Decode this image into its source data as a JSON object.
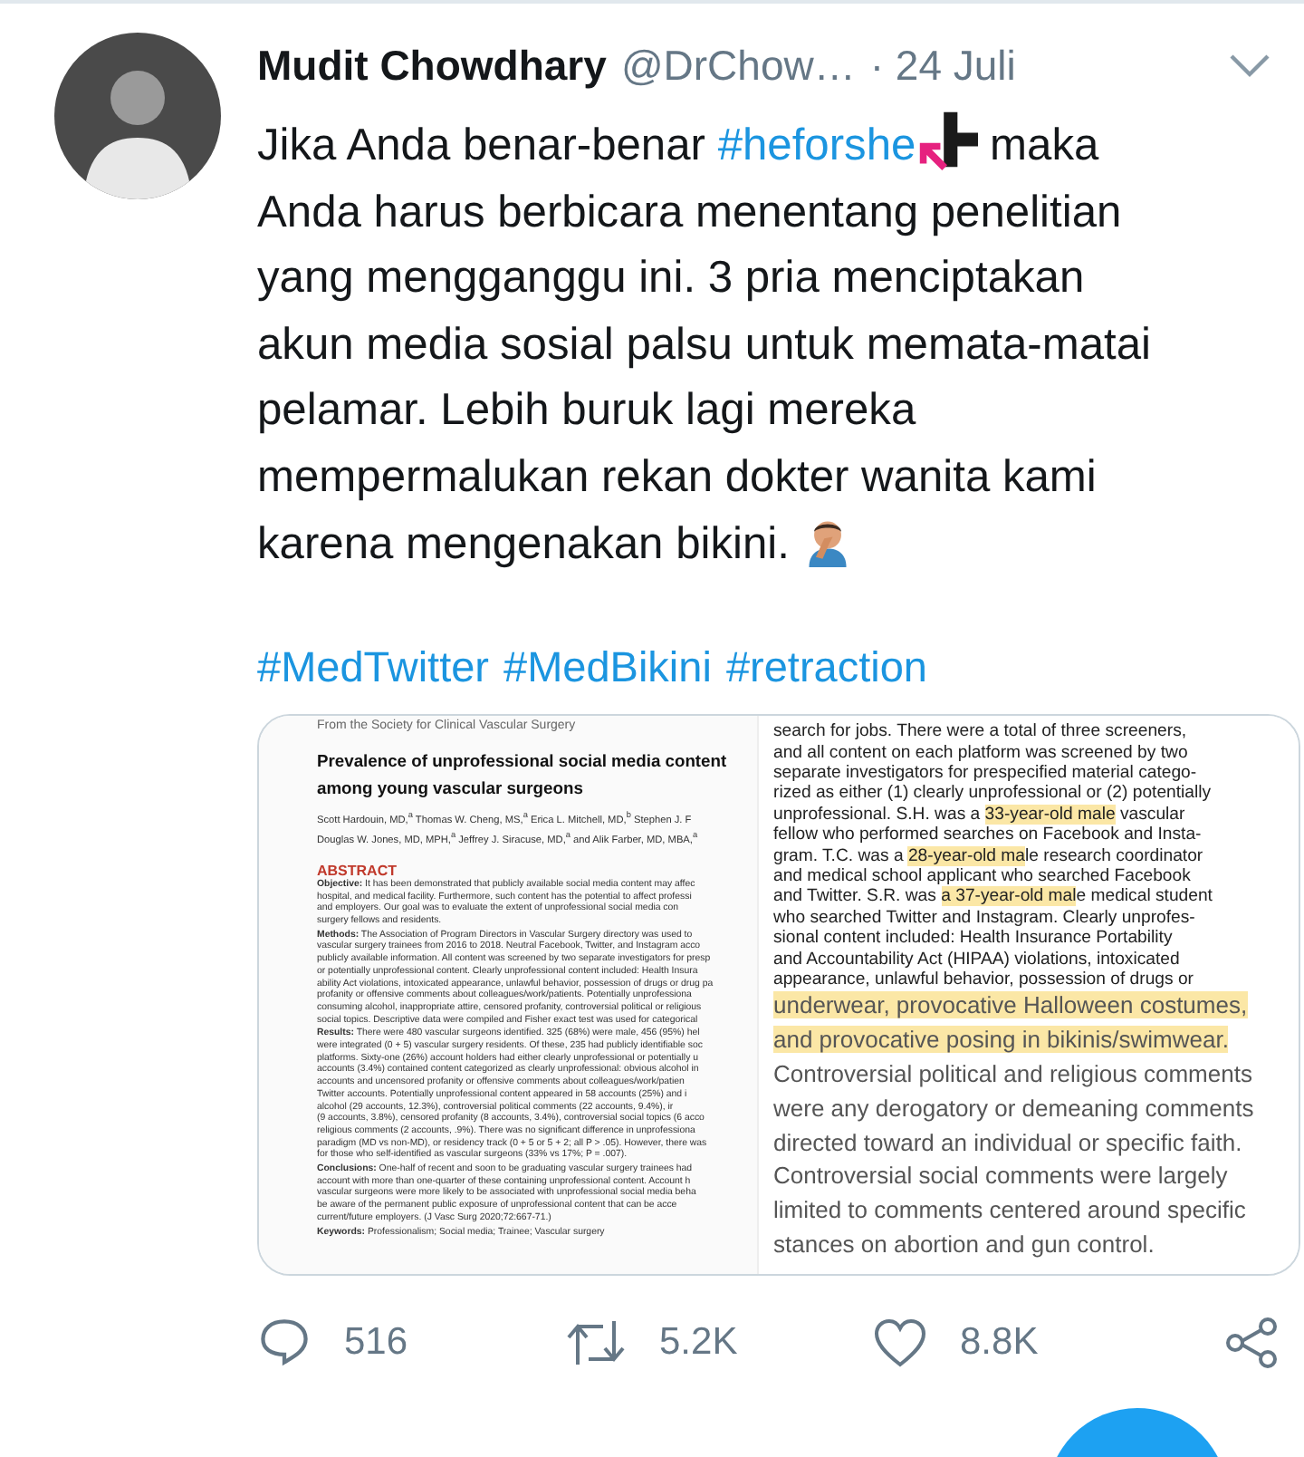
{
  "tweet": {
    "author": {
      "name": "Mudit Chowdhary",
      "handle": "@DrChow…",
      "date": "· 24 Juli"
    },
    "body": [
      {
        "kind": "text",
        "text": "Jika Anda benar-benar "
      },
      {
        "kind": "hashtag",
        "text": "#heforshe"
      },
      {
        "kind": "logo"
      },
      {
        "kind": "text",
        "text": " maka Anda harus berbicara menentang penelitian yang mengganggu ini. 3 pria menciptakan akun media sosial palsu untuk memata-matai pelamar. Lebih buruk lagi mereka mempermalukan rekan dokter wanita kami karena mengenakan bikini. "
      },
      {
        "kind": "emoji"
      }
    ],
    "hashtags": [
      "#MedTwitter",
      "#MedBikini",
      "#retraction"
    ],
    "media": {
      "left_page": {
        "source": "From the Society for Clinical Vascular Surgery",
        "title": [
          "Prevalence of unprofessional social media content",
          "among young vascular surgeons"
        ],
        "authors": [
          "Scott Hardouin, MD,$^{a}$ Thomas W. Cheng, MS,$^{a}$ Erica L. Mitchell, MD,$^{b}$ Stephen J. F",
          "Douglas W. Jones, MD, MPH,$^{a}$ Jeffrey J. Siracuse, MD,$^{a}$ and Alik Farber, MD, MBA,$^{a}$"
        ],
        "heading": "ABSTRACT",
        "paragraphs": [
          [
            "**Objective:** It has been demonstrated that publicly available social media content may affec",
            "hospital, and medical facility. Furthermore, such content has the potential to affect professi",
            "and employers. Our goal was to evaluate the extent of unprofessional social media con",
            "surgery fellows and residents."
          ],
          [
            "**Methods:** The Association of Program Directors in Vascular Surgery directory was used to",
            "vascular surgery trainees from 2016 to 2018. Neutral Facebook, Twitter, and Instagram acco",
            "publicly available information. All content was screened by two separate investigators for presp",
            "or potentially unprofessional content. Clearly unprofessional content included: Health Insura",
            "ability Act violations, intoxicated appearance, unlawful behavior, possession of drugs or drug pa",
            "profanity or offensive comments about colleagues/work/patients. Potentially unprofessiona",
            "consuming alcohol, inappropriate attire, censored profanity, controversial political or religious",
            "social topics. Descriptive data were compiled and Fisher exact test was used for categorical"
          ],
          [
            "**Results:** There were 480 vascular surgeons identified. 325 (68%) were male, 456 (95%) hel",
            "were integrated (0 + 5) vascular surgery residents. Of these, 235 had publicly identifiable soc",
            "platforms. Sixty-one (26%) account holders had either clearly unprofessional or potentially u",
            "accounts (3.4%) contained content categorized as clearly unprofessional: obvious alcohol in",
            "accounts and uncensored profanity or offensive comments about colleagues/work/patien",
            "Twitter accounts. Potentially unprofessional content appeared in 58 accounts (25%) and i",
            "alcohol (29 accounts, 12.3%), controversial political comments (22 accounts, 9.4%), ir",
            "(9 accounts, 3.8%), censored profanity (8 accounts, 3.4%), controversial social topics (6 acco",
            "religious comments (2 accounts, .9%). There was no significant difference in unprofessiona",
            "paradigm (MD vs non-MD), or residency track (0 + 5 or 5 + 2; all P > .05). However, there was",
            "for those who self-identified as vascular surgeons (33% vs 17%; P = .007)."
          ],
          [
            "**Conclusions:** One-half of recent and soon to be graduating vascular surgery trainees had",
            "account with more than one-quarter of these containing unprofessional content. Account h",
            "vascular surgeons were more likely to be associated with unprofessional social media beha",
            "be aware of the permanent public exposure of unprofessional content that can be acce",
            "current/future employers. (J Vasc Surg 2020;72:667-71.)"
          ],
          [
            "**Keywords:** Professionalism; Social media; Trainee; Vascular surgery"
          ]
        ]
      },
      "right_page": [
        {
          "kind": "small",
          "segments": [
            {
              "text": "search for jobs. There were a total of three screeners,",
              "highlight": false
            }
          ]
        },
        {
          "kind": "small",
          "segments": [
            {
              "text": "and all content on each platform was screened by two",
              "highlight": false
            }
          ]
        },
        {
          "kind": "small",
          "segments": [
            {
              "text": "separate investigators for prespecified material catego-",
              "highlight": false
            }
          ]
        },
        {
          "kind": "small",
          "segments": [
            {
              "text": "rized as either (1) clearly unprofessional or (2) potentially",
              "highlight": false
            }
          ]
        },
        {
          "kind": "small",
          "segments": [
            {
              "text": "unprofessional. S.H. was a ",
              "highlight": false
            },
            {
              "text": "33-year-old male",
              "highlight": true
            },
            {
              "text": " vascular",
              "highlight": false
            }
          ]
        },
        {
          "kind": "small",
          "segments": [
            {
              "text": "fellow who performed searches on Facebook and Insta-",
              "highlight": false
            }
          ]
        },
        {
          "kind": "small",
          "segments": [
            {
              "text": "gram. T.C. was a ",
              "highlight": false
            },
            {
              "text": "28-year-old ma",
              "highlight": true
            },
            {
              "text": "le research coordinator",
              "highlight": false
            }
          ]
        },
        {
          "kind": "small",
          "segments": [
            {
              "text": "and medical school applicant who searched Facebook",
              "highlight": false
            }
          ]
        },
        {
          "kind": "small",
          "segments": [
            {
              "text": "and Twitter. S.R. was ",
              "highlight": false
            },
            {
              "text": "a 37-year-old mal",
              "highlight": true
            },
            {
              "text": "e medical student",
              "highlight": false
            }
          ]
        },
        {
          "kind": "small",
          "segments": [
            {
              "text": "who searched Twitter and Instagram. Clearly unprofes-",
              "highlight": false
            }
          ]
        },
        {
          "kind": "small",
          "segments": [
            {
              "text": "sional content included: Health Insurance Portability",
              "highlight": false
            }
          ]
        },
        {
          "kind": "small",
          "segments": [
            {
              "text": "and Accountability Act (HIPAA) violations, intoxicated",
              "highlight": false
            }
          ]
        },
        {
          "kind": "small",
          "segments": [
            {
              "text": "appearance, unlawful behavior, possession of drugs or",
              "highlight": false
            }
          ]
        },
        {
          "kind": "large",
          "segments": [
            {
              "text": "underwear, provocative Halloween costumes,",
              "highlight": true
            }
          ]
        },
        {
          "kind": "large",
          "segments": [
            {
              "text": "and provocative posing in bikinis/swimwear.",
              "highlight": true
            }
          ]
        },
        {
          "kind": "large",
          "segments": [
            {
              "text": "Controversial political and religious comments",
              "highlight": false
            }
          ]
        },
        {
          "kind": "large",
          "segments": [
            {
              "text": "were any derogatory or demeaning comments",
              "highlight": false
            }
          ]
        },
        {
          "kind": "large",
          "segments": [
            {
              "text": "directed toward an individual or specific faith.",
              "highlight": false
            }
          ]
        },
        {
          "kind": "large",
          "segments": [
            {
              "text": "Controversial social comments were largely",
              "highlight": false
            }
          ]
        },
        {
          "kind": "large",
          "segments": [
            {
              "text": "limited to comments centered around specific",
              "highlight": false
            }
          ]
        },
        {
          "kind": "large",
          "segments": [
            {
              "text": "stances on abortion and gun control.",
              "highlight": false
            }
          ]
        }
      ]
    },
    "actions": {
      "replies": "516",
      "retweets": "5.2K",
      "likes": "8.8K"
    }
  }
}
